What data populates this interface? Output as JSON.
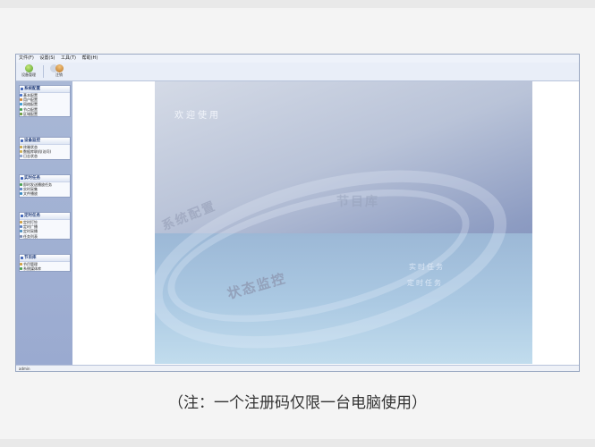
{
  "menu": [
    "文件(F)",
    "设置(S)",
    "工具(T)",
    "帮助(H)"
  ],
  "toolbar": {
    "buttons": [
      {
        "label": "设备管理",
        "icon": "device-icon"
      },
      {
        "label": "",
        "icon": "disabled-icon"
      },
      {
        "label": "注销",
        "icon": "user-icon"
      }
    ]
  },
  "sidebar": {
    "panels": [
      {
        "title": "系统配置",
        "items": [
          "基本配置",
          "用户配置",
          "网络配置",
          "节点配置",
          "区域配置"
        ]
      },
      {
        "title": "设备监控",
        "items": [
          "终端状态",
          "数据库联机(访问)",
          "日志状态"
        ]
      },
      {
        "title": "实时任务",
        "items": [
          "即时发送播放任务",
          "实时采集",
          "文件播放"
        ]
      },
      {
        "title": "定时任务",
        "items": [
          "定时打铃",
          "定时广播",
          "定时采播",
          "任务列表"
        ]
      },
      {
        "title": "节目库",
        "items": [
          "节目管理",
          "系统媒体库"
        ]
      }
    ]
  },
  "welcome": {
    "title": "欢迎使用",
    "watermarks": [
      "系统配置",
      "状态监控",
      "节目库"
    ],
    "features": [
      "实时任务",
      "定时任务"
    ]
  },
  "statusbar": {
    "text": "admin"
  },
  "caption": "（注：一个注册码仅限一台电脑使用）",
  "colors": {
    "sidebar": "#a9b8d6",
    "accent": "#3d63b8",
    "panel_header_text": "#1d3a7a"
  }
}
